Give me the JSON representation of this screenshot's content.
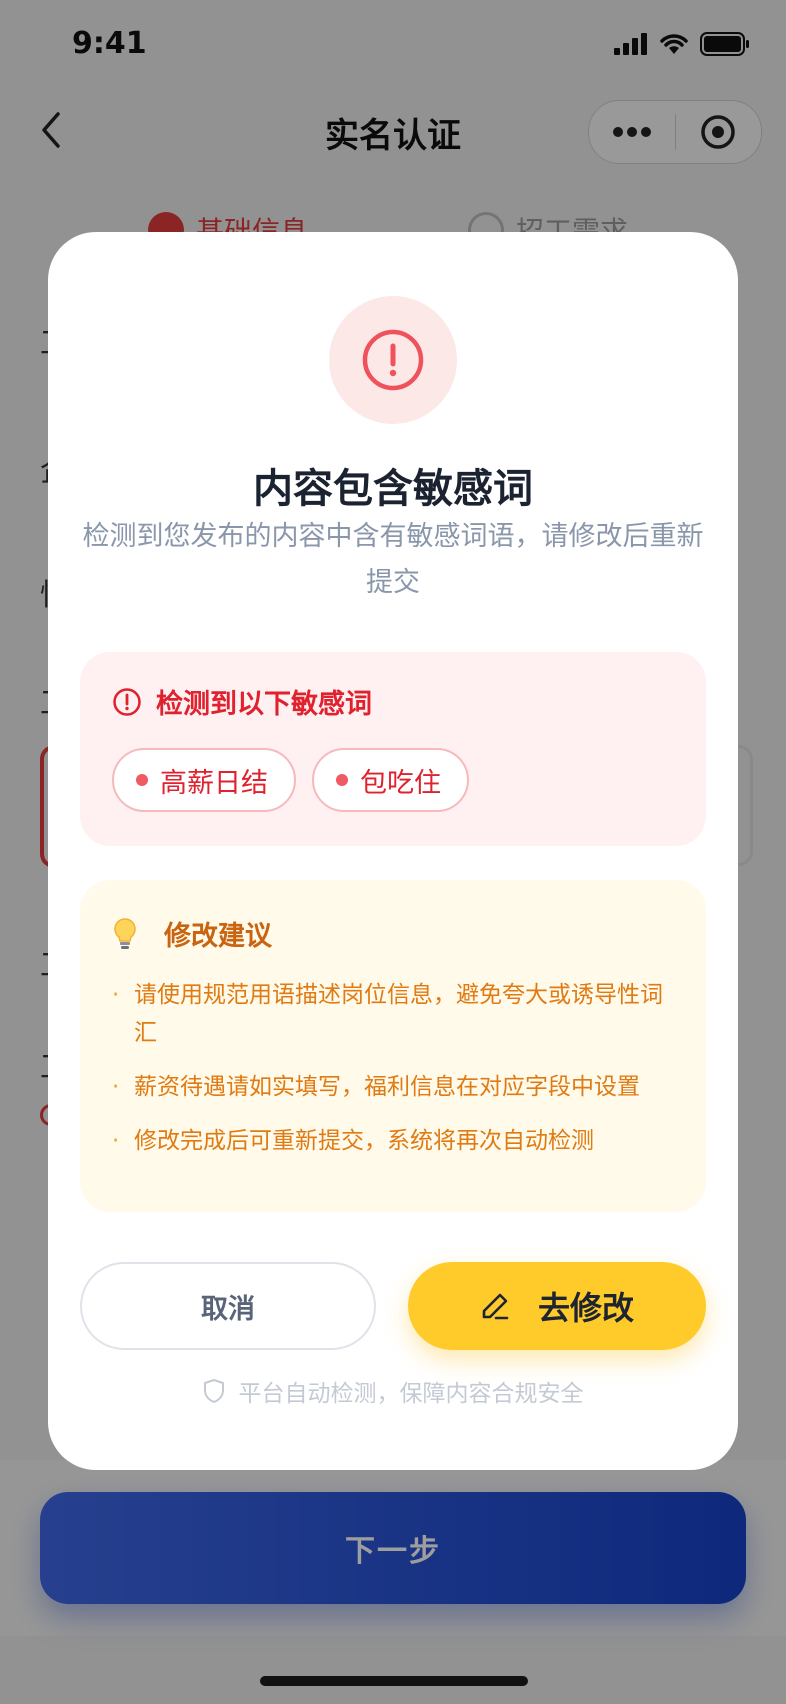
{
  "status_bar": {
    "time": "9:41"
  },
  "nav": {
    "title": "实名认证"
  },
  "steps": [
    {
      "label": "基础信息"
    },
    {
      "label": "招工需求"
    }
  ],
  "background_labels": [
    "工",
    "企",
    "性",
    "工",
    "工",
    "工"
  ],
  "bottom": {
    "next_label": "下一步"
  },
  "modal": {
    "title": "内容包含敏感词",
    "description": "检测到您发布的内容中含有敏感词语，请修改后重新提交",
    "sensitive": {
      "heading": "检测到以下敏感词",
      "words": [
        "高薪日结",
        "包吃住"
      ]
    },
    "suggestions": {
      "heading": "修改建议",
      "items": [
        "请使用规范用语描述岗位信息，避免夸大或诱导性词汇",
        "薪资待遇请如实填写，福利信息在对应字段中设置",
        "修改完成后可重新提交，系统将再次自动检测"
      ]
    },
    "cancel_label": "取消",
    "edit_label": "去修改",
    "footnote": "平台自动检测，保障内容合规安全"
  },
  "colors": {
    "accent_yellow": "#ffcb2b",
    "danger_red": "#e0212e",
    "primary_blue": "#1742c8"
  }
}
